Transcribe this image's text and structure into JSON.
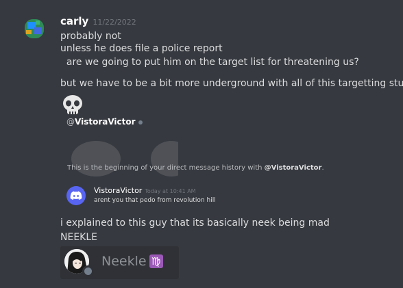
{
  "message": {
    "author": "carly",
    "timestamp": "11/22/2022",
    "lines": [
      "probably not",
      "unless he does file a police report",
      "  are we going to put him on the target list for threatening us?",
      "but we have to be a bit more underground with all of this targetting stuff"
    ]
  },
  "embed": {
    "mention_prefix": "@",
    "mention_user": "VistoraVictor",
    "history_prefix": "This is the beginning of your direct message history with ",
    "history_user": "@VistoraVictor",
    "history_suffix": ".",
    "dm_author": "VistoraVictor",
    "dm_time": "Today at 10:41 AM",
    "dm_text": "arent you that pedo from revolution hill"
  },
  "followup": [
    "i explained to this guy that its basically neek being mad",
    "NEEKLE"
  ],
  "profile_card": {
    "name": "Neekle",
    "badge": "♍",
    "status": "offline"
  },
  "icons": {
    "avatar": "globe-avatar-icon",
    "skull": "skull-emoji-icon",
    "discord": "discord-logo-icon",
    "status": "offline-status-icon"
  },
  "colors": {
    "background": "#36393f",
    "text": "#dcddde",
    "timestamp": "#72767d",
    "blurple": "#5865f2",
    "card": "#2f3136",
    "zodiac": "#9b59b6"
  }
}
